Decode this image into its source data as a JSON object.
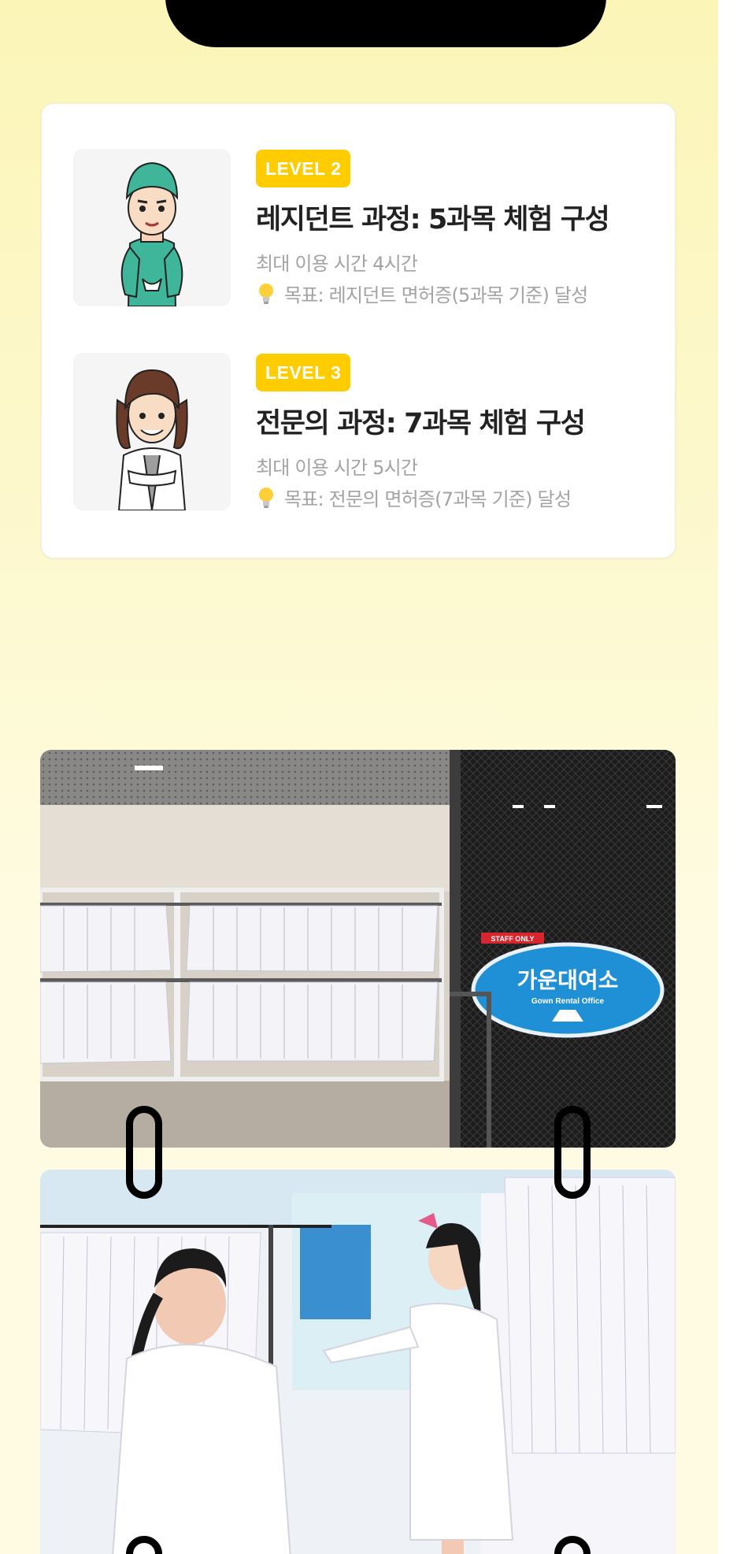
{
  "levels": [
    {
      "badge": "LEVEL 2",
      "title": "레지던트 과정: 5과목 체험 구성",
      "time": "최대 이용 시간 4시간",
      "goal": "목표: 레지던트 면허증(5과목 기준) 달성",
      "illustration": "surgeon-character"
    },
    {
      "badge": "LEVEL 3",
      "title": "전문의 과정: 7과목 체험 구성",
      "time": "최대 이용 시간 5시간",
      "goal": "목표: 전문의 면허증(7과목 기준) 달성",
      "illustration": "doctor-character"
    }
  ],
  "photos": {
    "rental_office": {
      "sign_text": "가운대여소",
      "sign_subtext": "Gown Rental Office",
      "staff_only": "STAFF ONLY"
    },
    "fitting": {}
  },
  "colors": {
    "badge": "#ffcc00",
    "background": "#fdf9d2",
    "sign": "#1f8fd6"
  }
}
